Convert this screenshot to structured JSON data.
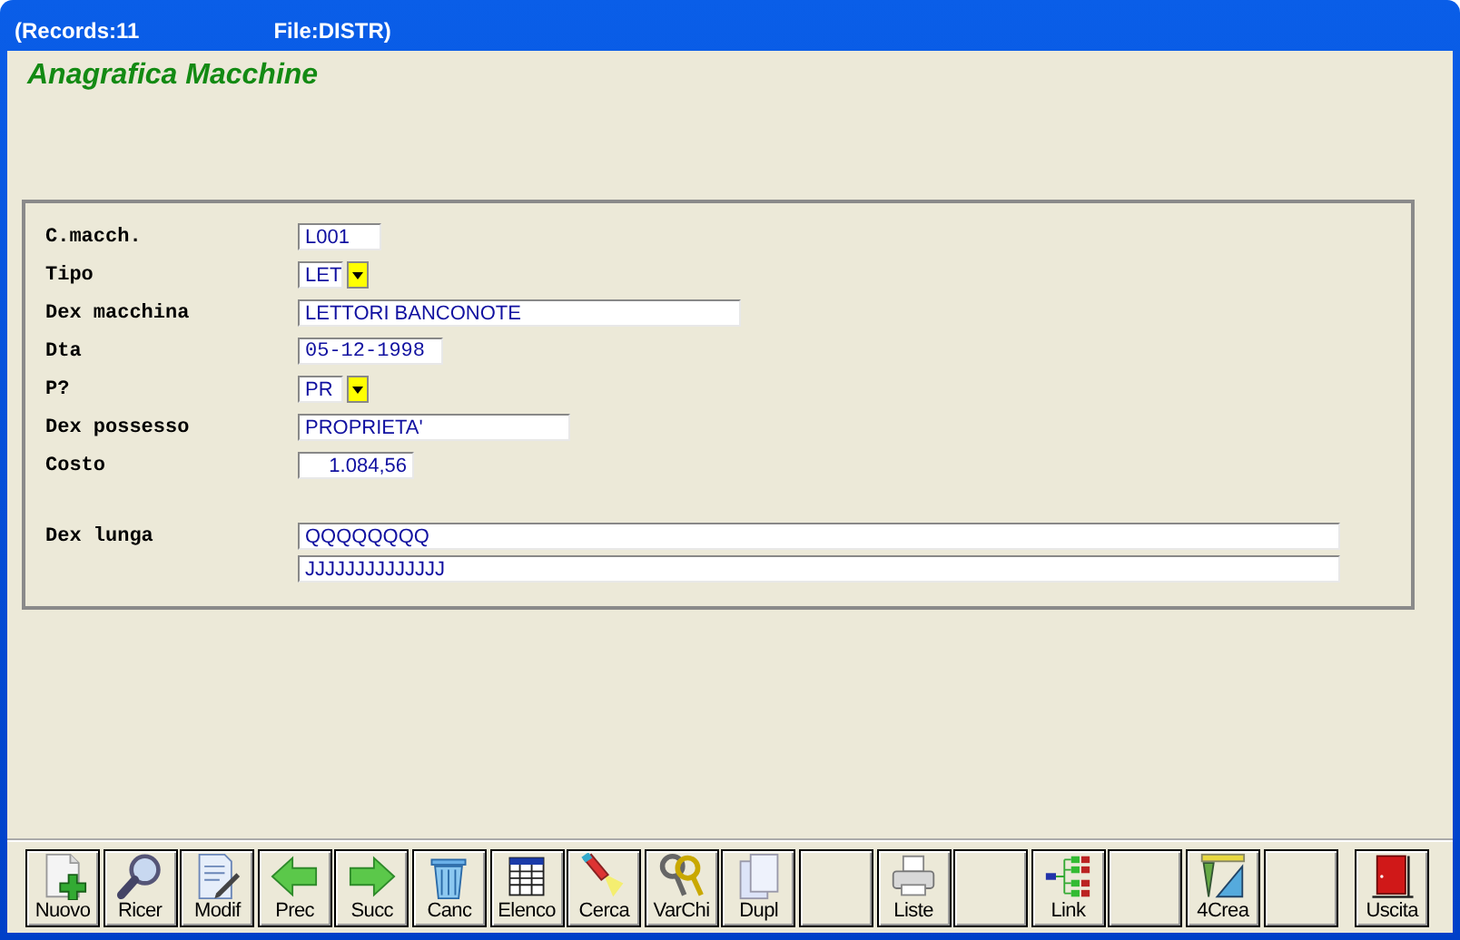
{
  "window": {
    "title_records": "(Records:11",
    "title_file": "File:DISTR)"
  },
  "heading": "Anagrafica Macchine",
  "fields": [
    {
      "label": "C.macch.",
      "kind": "text",
      "value": "L001"
    },
    {
      "label": "Tipo",
      "kind": "combo",
      "value": "LET"
    },
    {
      "label": "Dex macchina",
      "kind": "text",
      "value": "LETTORI BANCONOTE"
    },
    {
      "label": "Dta",
      "kind": "date",
      "value": "05-12-1998"
    },
    {
      "label": "P?",
      "kind": "combo",
      "value": "PR"
    },
    {
      "label": "Dex possesso",
      "kind": "text",
      "value": "PROPRIETA'"
    },
    {
      "label": "Costo",
      "kind": "number",
      "value": "1.084,56"
    },
    {
      "label": "Dex lunga",
      "kind": "long",
      "values": [
        "QQQQQQQQ",
        "JJJJJJJJJJJJJJ"
      ]
    }
  ],
  "toolbar": [
    {
      "label": "Nuovo",
      "kind": "new"
    },
    {
      "label": "Ricer",
      "kind": "magnifier"
    },
    {
      "label": "Modif",
      "kind": "edit"
    },
    {
      "label": "Prec",
      "kind": "left"
    },
    {
      "label": "Succ",
      "kind": "right"
    },
    {
      "label": "Canc",
      "kind": "trash"
    },
    {
      "label": "Elenco",
      "kind": "table"
    },
    {
      "label": "Cerca",
      "kind": "flashlight"
    },
    {
      "label": "VarChi",
      "kind": "keys"
    },
    {
      "label": "Dupl",
      "kind": "copy"
    },
    {
      "kind": "blank"
    },
    {
      "label": "Liste",
      "kind": "printer"
    },
    {
      "kind": "blank"
    },
    {
      "label": "Link",
      "kind": "tree"
    },
    {
      "kind": "blank"
    },
    {
      "label": "4Crea",
      "kind": "ruler"
    },
    {
      "kind": "blank"
    },
    {
      "label": "Uscita",
      "kind": "door"
    }
  ]
}
